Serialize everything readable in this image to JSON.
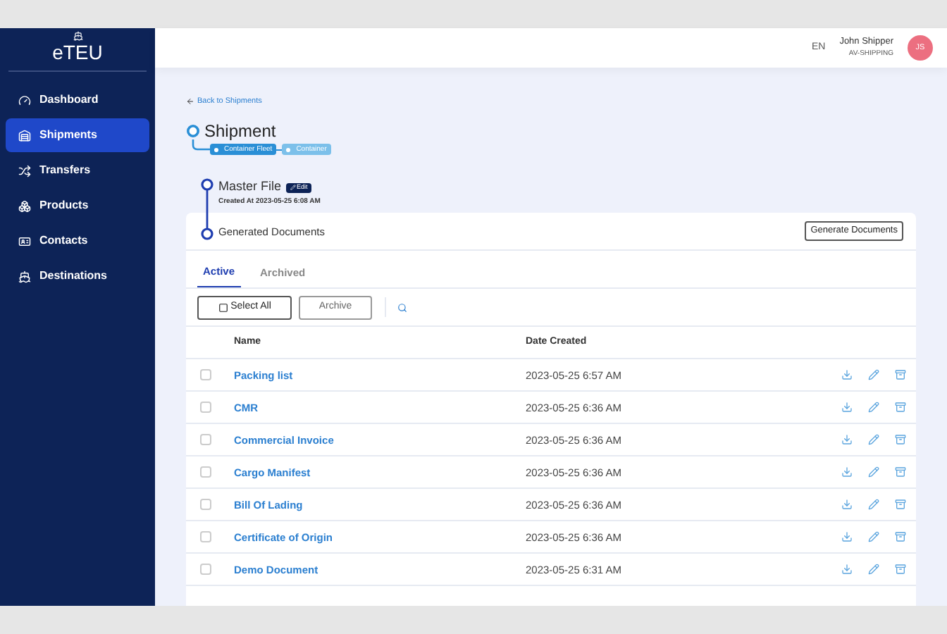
{
  "sidebar": {
    "logo": "eTEU",
    "items": [
      {
        "label": "Dashboard",
        "selected": false
      },
      {
        "label": "Shipments",
        "selected": true
      },
      {
        "label": "Transfers",
        "selected": false
      },
      {
        "label": "Products",
        "selected": false
      },
      {
        "label": "Contacts",
        "selected": false
      },
      {
        "label": "Destinations",
        "selected": false
      }
    ]
  },
  "header": {
    "language": "EN",
    "user_name": "John Shipper",
    "company": "AV-SHIPPING",
    "avatar_initials": "JS"
  },
  "back_link": "Back to Shipments",
  "shipment": {
    "title": "Shipment",
    "breadcrumbs": [
      {
        "label": "Container Fleet",
        "selected": true
      },
      {
        "label": "Container",
        "selected": false
      }
    ]
  },
  "master_file": {
    "title": "Master File",
    "edit_label": "Edit",
    "created": "Created At 2023-05-25 6:08 AM"
  },
  "documents": {
    "title": "Generated Documents",
    "generate_button": "Generate Documents",
    "tabs": [
      {
        "label": "Active",
        "selected": true
      },
      {
        "label": "Archived",
        "selected": false
      }
    ],
    "select_all": "Select All",
    "archive_button": "Archive",
    "columns": [
      "Name",
      "Date Created"
    ],
    "rows": [
      {
        "name": "Packing list",
        "date": "2023-05-25 6:57 AM",
        "checked": false
      },
      {
        "name": "CMR",
        "date": "2023-05-25 6:36 AM",
        "checked": false
      },
      {
        "name": "Commercial Invoice",
        "date": "2023-05-25 6:36 AM",
        "checked": false
      },
      {
        "name": "Cargo Manifest",
        "date": "2023-05-25 6:36 AM",
        "checked": false
      },
      {
        "name": "Bill Of Lading",
        "date": "2023-05-25 6:36 AM",
        "checked": false
      },
      {
        "name": "Certificate of Origin",
        "date": "2023-05-25 6:36 AM",
        "checked": false
      },
      {
        "name": "Demo Document",
        "date": "2023-05-25 6:31 AM",
        "checked": false
      }
    ]
  }
}
